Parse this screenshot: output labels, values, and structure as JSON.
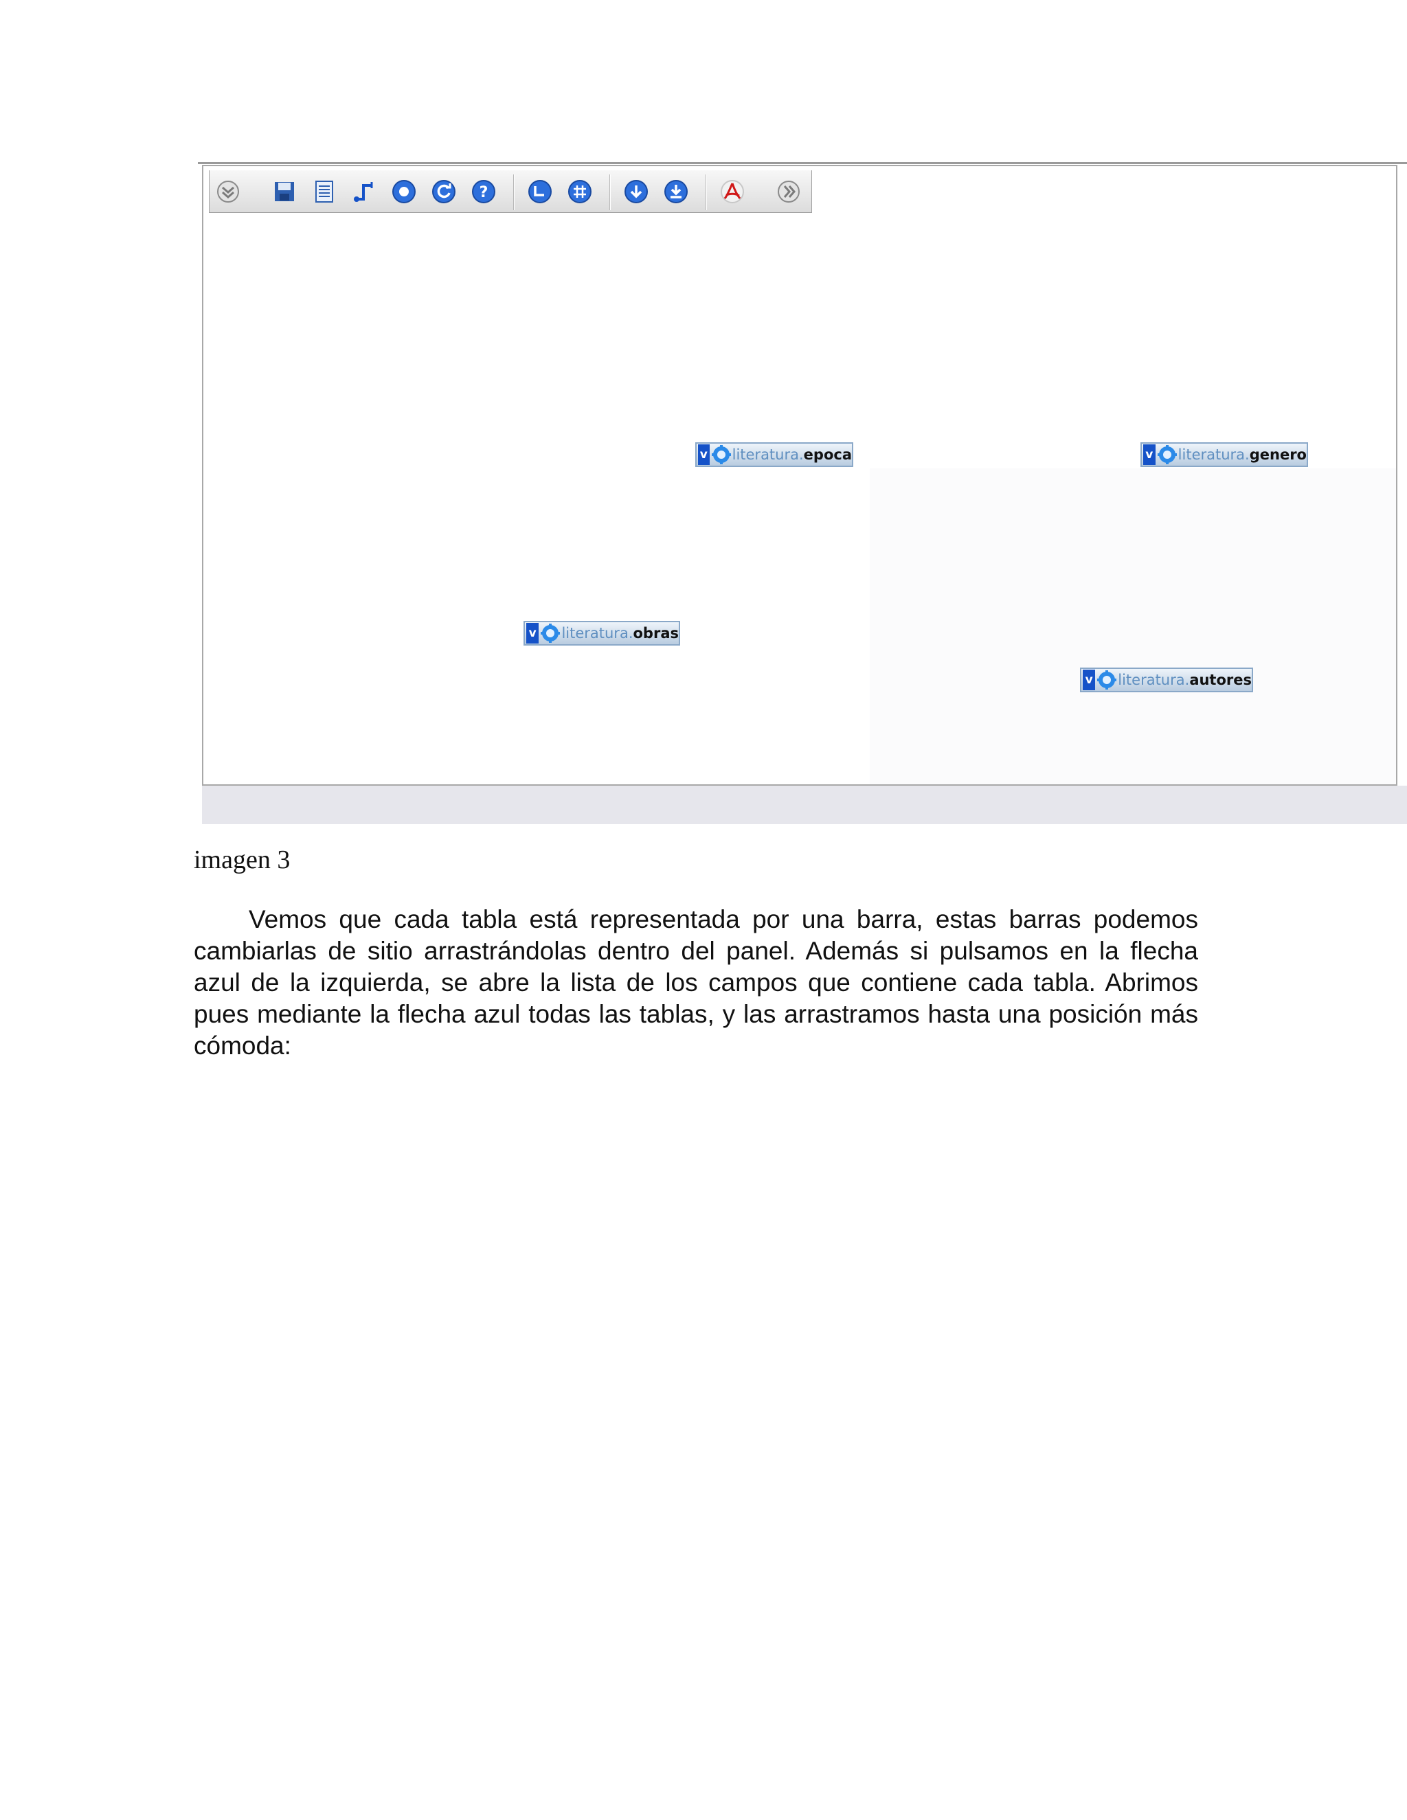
{
  "figure": {
    "toolbar_icons": [
      "collapse-icon",
      "save-icon",
      "list-icon",
      "relation-icon",
      "stop-icon",
      "refresh-icon",
      "help-icon",
      "undo-icon",
      "grid-icon",
      "import-icon",
      "export-icon",
      "pdf-icon",
      "expand-icon"
    ],
    "tables": [
      {
        "schema": "literatura",
        "name": "epoca"
      },
      {
        "schema": "literatura",
        "name": "genero"
      },
      {
        "schema": "literatura",
        "name": "obras"
      },
      {
        "schema": "literatura",
        "name": "autores"
      }
    ],
    "table_toggle_label": "v",
    "accent_color": "#1552c8"
  },
  "caption": "imagen 3",
  "paragraph": "Vemos que cada tabla está representada por una barra, estas barras podemos cambiarlas de sitio arrastrándolas dentro del panel. Además si pulsamos en la flecha azul de la izquierda, se abre la lista de los campos que contiene cada tabla. Abrimos pues mediante la flecha azul todas las tablas, y las arrastramos hasta una posición más cómoda:"
}
